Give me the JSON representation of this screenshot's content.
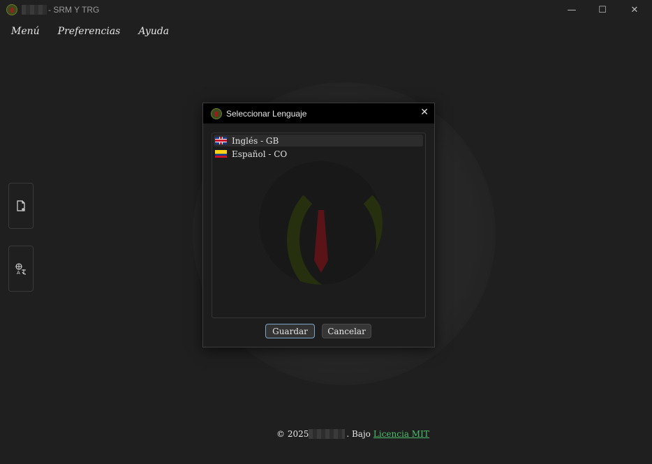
{
  "window": {
    "title": "- SRM Y TRG",
    "minimize": "—",
    "maximize": "☐",
    "close": "✕"
  },
  "menu": {
    "items": [
      "Menú",
      "Preferencias",
      "Ayuda"
    ]
  },
  "sidebar": {
    "buttons": [
      {
        "icon": "new-file-icon"
      },
      {
        "icon": "translate-icon"
      }
    ]
  },
  "dialog": {
    "title": "Seleccionar Lenguaje",
    "close": "✕",
    "languages": [
      {
        "label": "Inglés - GB",
        "flag": "gb-flag-icon",
        "selected": true
      },
      {
        "label": "Español - CO",
        "flag": "co-flag-icon",
        "selected": false
      }
    ],
    "save_label": "Guardar",
    "cancel_label": "Cancelar"
  },
  "footer": {
    "copyright": "© 2025",
    "under": ". Bajo",
    "license_link": "Licencia MIT"
  },
  "colors": {
    "background": "#1f1f1f",
    "link": "#4bbf6b",
    "primary_border": "#7aa6c8"
  }
}
